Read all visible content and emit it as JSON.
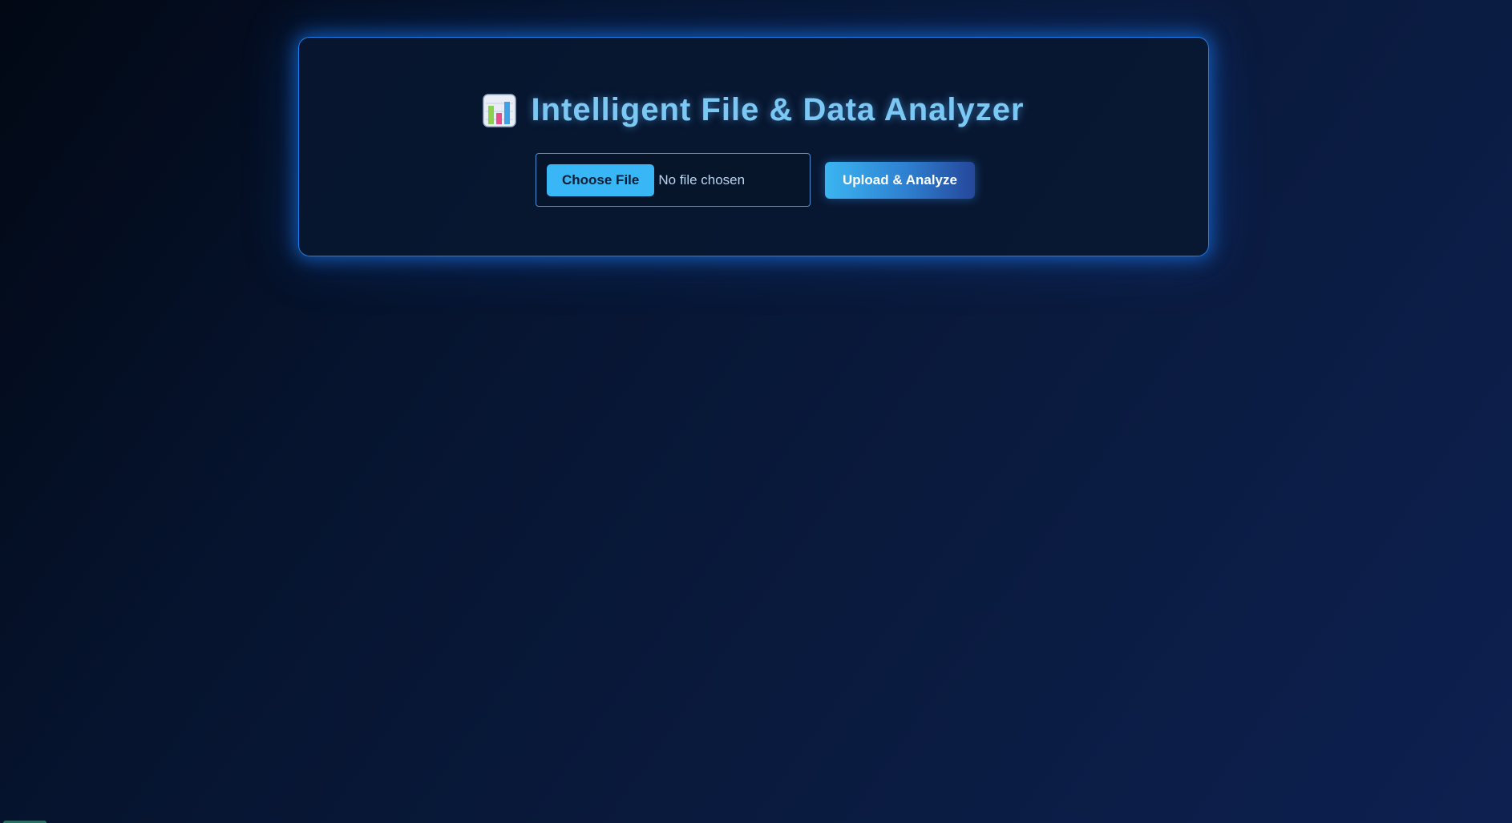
{
  "header": {
    "icon": "bar-chart-icon",
    "title": "Intelligent File & Data Analyzer"
  },
  "upload": {
    "choose_label": "Choose File",
    "status_text": "No file chosen",
    "analyze_label": "Upload & Analyze"
  },
  "colors": {
    "accent": "#38b6f5",
    "title": "#7cc8f5",
    "border_glow": "#1f7fe6"
  }
}
